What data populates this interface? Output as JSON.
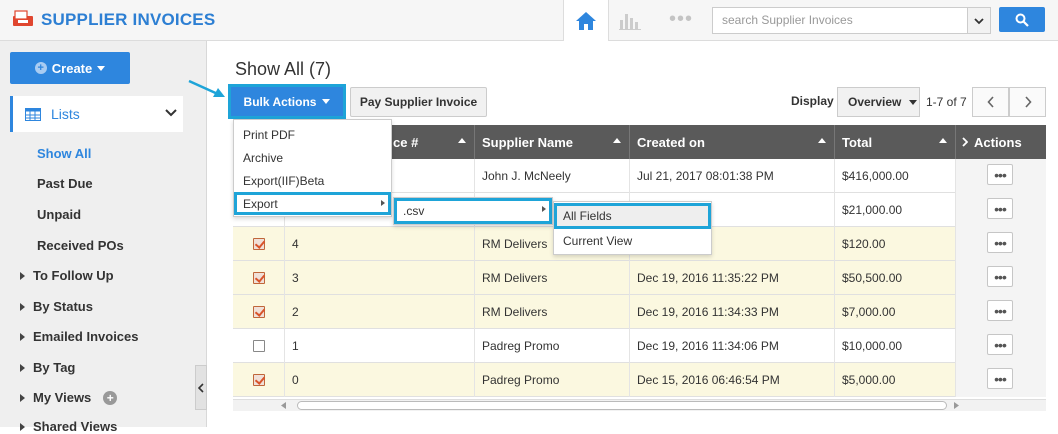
{
  "app": {
    "title": "SUPPLIER INVOICES"
  },
  "search": {
    "placeholder": "search Supplier Invoices"
  },
  "sidebar": {
    "create_label": "Create",
    "lists_label": "Lists",
    "items": [
      "Show All",
      "Past Due",
      "Unpaid",
      "Received POs"
    ],
    "groups": [
      "To Follow Up",
      "By Status",
      "Emailed Invoices",
      "By Tag",
      "My Views",
      "Shared Views"
    ]
  },
  "main": {
    "title": "Show All (7)",
    "bulk_actions_label": "Bulk Actions",
    "pay_label": "Pay Supplier Invoice",
    "display_label": "Display",
    "display_value": "Overview",
    "pager_text": "1-7 of 7",
    "prev": "‹",
    "next": "›"
  },
  "table": {
    "headers": {
      "invoice": "ce #",
      "supplier": "Supplier Name",
      "created": "Created on",
      "total": "Total",
      "actions": "Actions"
    },
    "rows": [
      {
        "checked": false,
        "no": "",
        "supplier": "John J. McNeely",
        "created": "Jul 21, 2017 08:01:38 PM",
        "total": "$416,000.00",
        "sel": false
      },
      {
        "checked": false,
        "no": "",
        "supplier": "",
        "created": "0:33:27 PM",
        "total": "$21,000.00",
        "sel": false
      },
      {
        "checked": true,
        "no": "4",
        "supplier": "RM Delivers",
        "created": "0:32:46 PM",
        "total": "$120.00",
        "sel": true
      },
      {
        "checked": true,
        "no": "3",
        "supplier": "RM Delivers",
        "created": "Dec 19, 2016 11:35:22 PM",
        "total": "$50,500.00",
        "sel": true
      },
      {
        "checked": true,
        "no": "2",
        "supplier": "RM Delivers",
        "created": "Dec 19, 2016 11:34:33 PM",
        "total": "$7,000.00",
        "sel": true
      },
      {
        "checked": false,
        "no": "1",
        "supplier": "Padreg Promo",
        "created": "Dec 19, 2016 11:34:06 PM",
        "total": "$10,000.00",
        "sel": false
      },
      {
        "checked": true,
        "no": "0",
        "supplier": "Padreg Promo",
        "created": "Dec 15, 2016 06:46:54 PM",
        "total": "$5,000.00",
        "sel": true
      }
    ]
  },
  "bulk_menu": {
    "items": [
      "Print PDF",
      "Archive",
      "Export(IIF)Beta",
      "Export"
    ]
  },
  "export_menu": {
    "items": [
      ".csv"
    ]
  },
  "csv_menu": {
    "items": [
      "All Fields",
      "Current View"
    ]
  },
  "colors": {
    "accent": "#2e86de",
    "highlight": "#1ea4d8",
    "selected_row": "#fbf8e0",
    "header": "#5a5a5a"
  }
}
